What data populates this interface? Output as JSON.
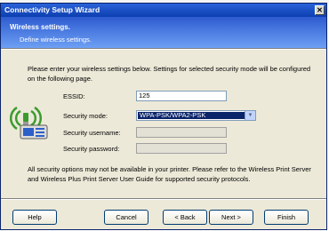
{
  "window": {
    "title": "Connectivity Setup Wizard",
    "close_glyph": "✕"
  },
  "header": {
    "title": "Wireless settings.",
    "subtitle": "Define wireless settings."
  },
  "intro": "Please enter your wireless settings below. Settings for selected security mode will be configured on the following page.",
  "form": {
    "essid": {
      "label": "ESSID:",
      "value": "125"
    },
    "security_mode": {
      "label": "Security mode:",
      "value": "WPA-PSK/WPA2-PSK"
    },
    "security_username": {
      "label": "Security username:",
      "value": ""
    },
    "security_password": {
      "label": "Security password:",
      "value": ""
    }
  },
  "note": "All security options may not be available in your printer. Please refer to the Wireless Print Server and Wireless Plus Print Server User Guide for supported security protocols.",
  "buttons": {
    "help": "Help",
    "cancel": "Cancel",
    "back": "< Back",
    "next": "Next >",
    "finish": "Finish"
  },
  "icons": {
    "wireless_printer": "wireless-printer-icon",
    "dropdown_arrow": "chevron-down-icon"
  },
  "colors": {
    "title_bar": "#0c3fb0",
    "header_start": "#2e5bd0",
    "header_end": "#6da0f4",
    "selection": "#0a246a",
    "dialog_bg": "#ece9d8"
  }
}
